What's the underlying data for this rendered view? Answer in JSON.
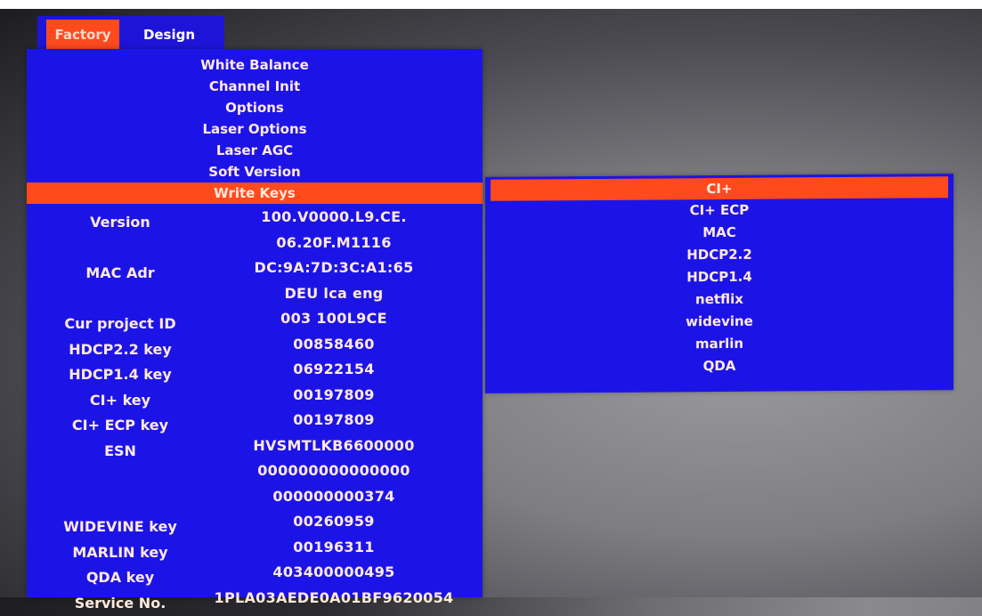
{
  "tabs": {
    "factory": "Factory",
    "design": "Design"
  },
  "menu": {
    "items": [
      {
        "label": "White Balance"
      },
      {
        "label": "Channel Init"
      },
      {
        "label": "Options"
      },
      {
        "label": "Laser Options"
      },
      {
        "label": "Laser AGC"
      },
      {
        "label": "Soft Version"
      },
      {
        "label": "Write Keys",
        "selected": true
      }
    ]
  },
  "info": {
    "rows": [
      {
        "label": "Version",
        "value": "100.V0000.L9.CE."
      },
      {
        "label": "",
        "value": "06.20F.M1116"
      },
      {
        "label": "MAC Adr",
        "value": "DC:9A:7D:3C:A1:65"
      },
      {
        "label": "",
        "value": "DEU lca eng"
      },
      {
        "label": "Cur project ID",
        "value": "003 100L9CE"
      },
      {
        "label": "HDCP2.2 key",
        "value": "00858460"
      },
      {
        "label": "HDCP1.4 key",
        "value": "06922154"
      },
      {
        "label": "CI+ key",
        "value": "00197809"
      },
      {
        "label": "CI+ ECP key",
        "value": "00197809"
      },
      {
        "label": "ESN",
        "value": "HVSMTLKB6600000"
      },
      {
        "label": "",
        "value": "000000000000000"
      },
      {
        "label": "",
        "value": "000000000374"
      },
      {
        "label": "WIDEVINE key",
        "value": "00260959"
      },
      {
        "label": "MARLIN key",
        "value": "00196311"
      },
      {
        "label": "QDA key",
        "value": "403400000495"
      },
      {
        "label": "Service No.",
        "value": "1PLA03AEDE0A01BF9620054"
      }
    ]
  },
  "submenu": {
    "items": [
      {
        "label": "CI+",
        "selected": true
      },
      {
        "label": "CI+ ECP"
      },
      {
        "label": "MAC"
      },
      {
        "label": "HDCP2.2"
      },
      {
        "label": "HDCP1.4"
      },
      {
        "label": "netflix"
      },
      {
        "label": "widevine"
      },
      {
        "label": "marlin"
      },
      {
        "label": "QDA"
      }
    ]
  },
  "colors": {
    "panel_blue": "#1c14e6",
    "highlight_orange": "#ff4a1e",
    "text": "#ffe9dd"
  }
}
